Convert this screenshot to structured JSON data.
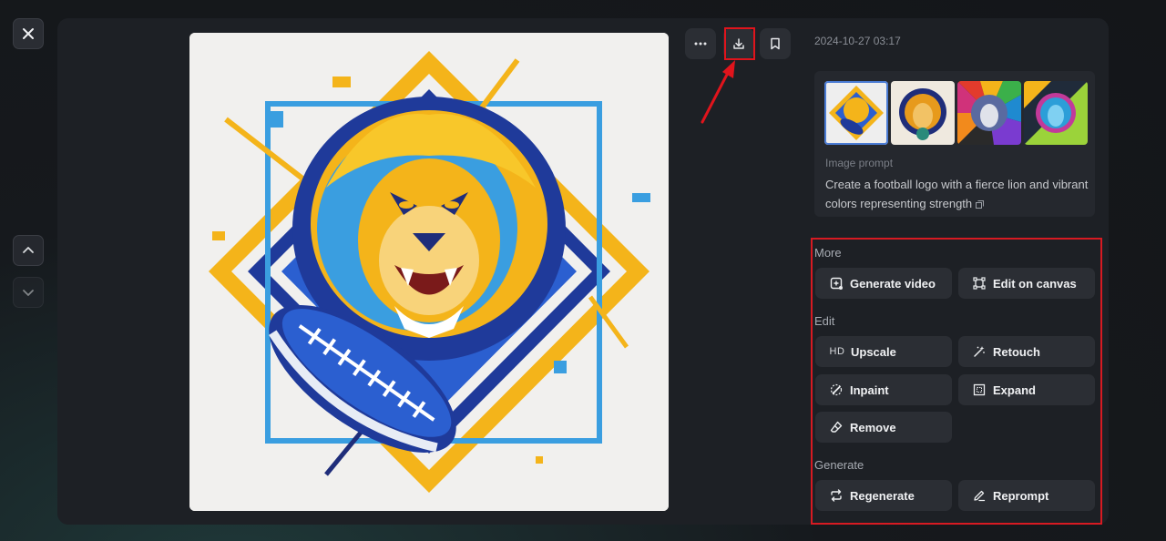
{
  "timestamp": "2024-10-27 03:17",
  "prompt": {
    "label": "Image prompt",
    "text": "Create a football logo with a fierce lion and vibrant colors representing strength"
  },
  "sections": {
    "more": "More",
    "edit": "Edit",
    "generate": "Generate"
  },
  "actions": {
    "generate_video": "Generate video",
    "edit_on_canvas": "Edit on canvas",
    "upscale": "Upscale",
    "upscale_icon_text": "HD",
    "retouch": "Retouch",
    "inpaint": "Inpaint",
    "expand": "Expand",
    "remove": "Remove",
    "regenerate": "Regenerate",
    "reprompt": "Reprompt"
  },
  "colors": {
    "highlight": "#e0141c",
    "panel": "#1d2025",
    "button": "#2b2e34"
  },
  "icons": {
    "close": "close-icon",
    "up": "chevron-up-icon",
    "down": "chevron-down-icon",
    "more": "ellipsis-icon",
    "download": "download-icon",
    "bookmark": "bookmark-icon"
  }
}
